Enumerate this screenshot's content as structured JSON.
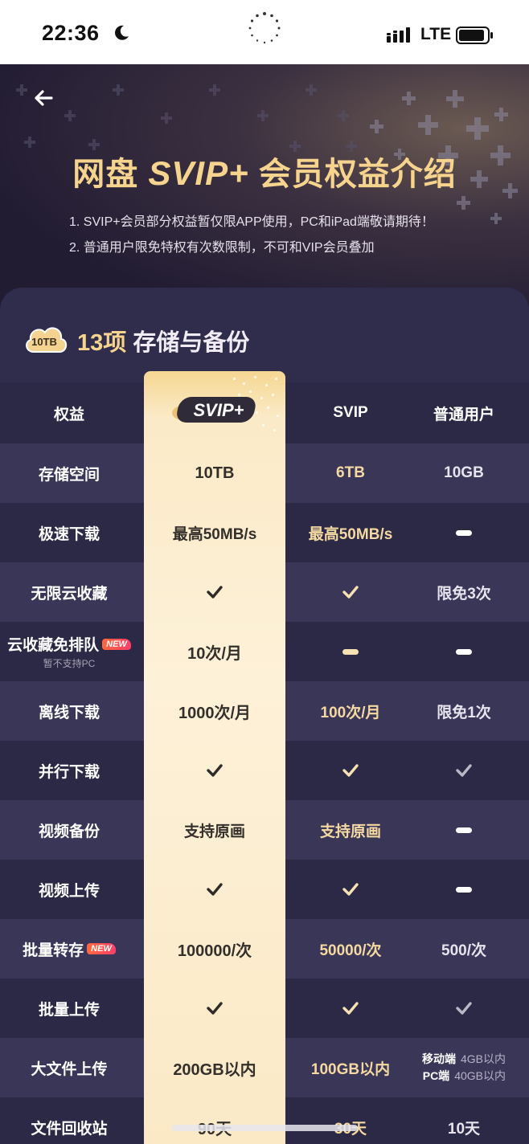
{
  "status_bar": {
    "time": "22:36",
    "network": "LTE"
  },
  "hero": {
    "title_part1": "网盘",
    "title_svip": "SVIP+",
    "title_part2": "会员权益介绍",
    "notes": [
      "1. SVIP+会员部分权益暂仅限APP使用，PC和iPad端敬请期待！",
      "2. 普通用户限免特权有次数限制，不可和VIP会员叠加"
    ]
  },
  "section": {
    "badge_text": "10TB",
    "count": "13项",
    "title": "存储与备份"
  },
  "table": {
    "headers": {
      "col1": "权益",
      "col2_logo": "SVIP+",
      "col3": "SVIP",
      "col4": "普通用户"
    },
    "new_badge": "NEW",
    "rows": [
      {
        "name": "存储空间",
        "svip_plus": "10TB",
        "svip": "6TB",
        "normal": "10GB"
      },
      {
        "name": "极速下载",
        "svip_plus": "最高50MB/s",
        "svip": "最高50MB/s"
      },
      {
        "name": "无限云收藏",
        "normal": "限免3次"
      },
      {
        "name": "云收藏免排队",
        "sub": "暂不支持PC",
        "svip_plus": "10次/月"
      },
      {
        "name": "离线下载",
        "svip_plus": "1000次/月",
        "svip": "100次/月",
        "normal": "限免1次"
      },
      {
        "name": "并行下载"
      },
      {
        "name": "视频备份",
        "svip_plus": "支持原画",
        "svip": "支持原画"
      },
      {
        "name": "视频上传"
      },
      {
        "name": "批量转存",
        "svip_plus": "100000/次",
        "svip": "50000/次",
        "normal": "500/次"
      },
      {
        "name": "批量上传"
      },
      {
        "name": "大文件上传",
        "svip_plus": "200GB以内",
        "svip": "100GB以内",
        "normal_mobile_label": "移动端",
        "normal_mobile_value": "4GB以内",
        "normal_pc_label": "PC端",
        "normal_pc_value": "40GB以内"
      },
      {
        "name": "文件回收站",
        "svip_plus": "90天",
        "svip": "30天",
        "normal": "10天"
      }
    ]
  },
  "icons": {
    "check": "check-icon",
    "dash": "dash-icon",
    "back": "back-arrow-icon"
  },
  "colors": {
    "gold": "#f6d48d",
    "card_bg": "#2f2c4c",
    "svip_plus_col": "#fdf1d8"
  }
}
